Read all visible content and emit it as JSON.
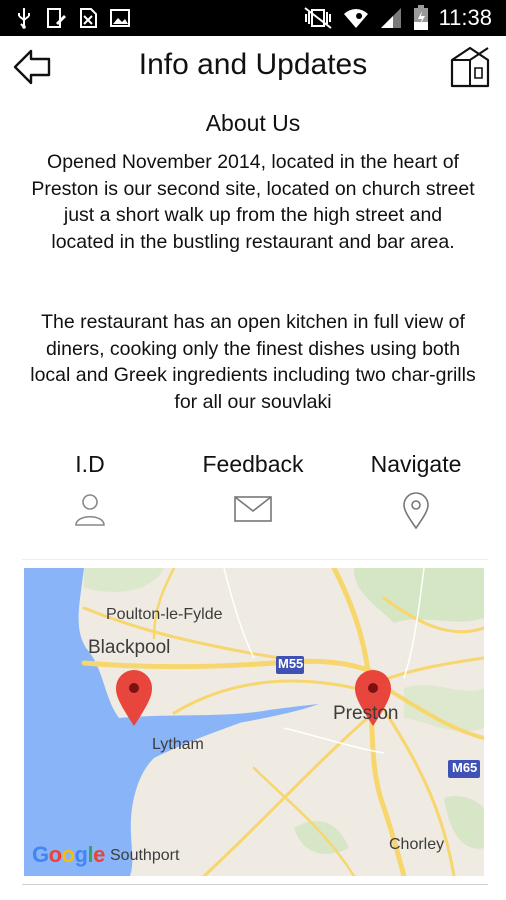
{
  "status_bar": {
    "time": "11:38",
    "left_icons": [
      "usb-icon",
      "phone-edit-icon",
      "sim-blocked-icon",
      "image-icon"
    ],
    "right_icons": [
      "vibrate-mute-icon",
      "wifi-icon",
      "signal-icon",
      "battery-icon"
    ]
  },
  "header": {
    "title": "Info and Updates",
    "back_icon": "back-arrow-icon",
    "home_icon": "home-icon"
  },
  "about": {
    "heading": "About Us",
    "paragraph1": "Opened November 2014, located in the heart of Preston is our second site, located on church street just a short walk up from the high street and located in the bustling restaurant and bar area.",
    "paragraph2": "The restaurant has an open kitchen in full view of diners, cooking only the finest dishes using both local and Greek ingredients including two char-grills for all our souvlaki"
  },
  "actions": [
    {
      "label": "I.D",
      "icon": "person-icon"
    },
    {
      "label": "Feedback",
      "icon": "envelope-icon"
    },
    {
      "label": "Navigate",
      "icon": "location-pin-icon"
    }
  ],
  "map": {
    "places": {
      "poulton": "Poulton-le-Fylde",
      "blackpool": "Blackpool",
      "preston": "Preston",
      "lytham": "Lytham",
      "southport": "Southport",
      "chorley": "Chorley"
    },
    "roads": {
      "m55": "M55",
      "m65": "M65"
    },
    "attribution": "Google",
    "colors": {
      "sea": "#8ab4f8",
      "land": "#efebe2",
      "roads": "#f7d66e",
      "pin": "#e8453c",
      "motorway_shield": "#3f51b5"
    }
  }
}
